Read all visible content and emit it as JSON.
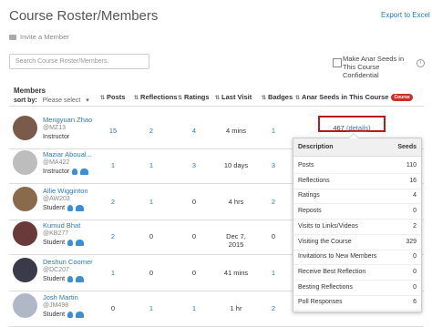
{
  "header": {
    "title": "Course Roster/Members",
    "export_label": "Export to Excel",
    "invite_label": "Invite a Member"
  },
  "search": {
    "placeholder": "Search Course Roster/Members."
  },
  "anonymous": {
    "label": "Make Anar Seeds in This Course Confidential"
  },
  "table": {
    "members_label": "Members",
    "sort_label": "sort by:",
    "sort_value": "Please select",
    "columns": [
      "Posts",
      "Reflections",
      "Ratings",
      "Last Visit",
      "Badges",
      "Anar Seeds in This Course"
    ],
    "course_badge": "Course",
    "rows": [
      {
        "name": "Mengyuan Zhao",
        "handle": "@MZ13",
        "role": "Instructor",
        "posts": "15",
        "reflections": "2",
        "ratings": "4",
        "last_visit": "4 mins",
        "badges": "1",
        "seeds": "467",
        "details": "(details)",
        "avatar": "#7a5a4a"
      },
      {
        "name": "Maziar Aboual...",
        "handle": "@MA422",
        "role": "Instructor",
        "posts": "1",
        "reflections": "1",
        "ratings": "3",
        "last_visit": "10 days",
        "badges": "3",
        "seeds": "",
        "details": "",
        "avatar": "#bdbdbd"
      },
      {
        "name": "Allie Wigginton",
        "handle": "@AW203",
        "role": "Student",
        "posts": "2",
        "reflections": "1",
        "ratings": "0",
        "last_visit": "4 hrs",
        "badges": "2",
        "seeds": "",
        "details": "",
        "avatar": "#8a6a4a"
      },
      {
        "name": "Kumud Bhat",
        "handle": "@KB277",
        "role": "Student",
        "posts": "2",
        "reflections": "0",
        "ratings": "0",
        "last_visit": "Dec 7, 2015",
        "badges": "0",
        "seeds": "",
        "details": "",
        "avatar": "#6a3a3a"
      },
      {
        "name": "Deshun Coomer",
        "handle": "@DC207",
        "role": "Student",
        "posts": "1",
        "reflections": "0",
        "ratings": "0",
        "last_visit": "41 mins",
        "badges": "1",
        "seeds": "",
        "details": "",
        "avatar": "#3a3a4a"
      },
      {
        "name": "Josh Martin",
        "handle": "@JM498",
        "role": "Student",
        "posts": "0",
        "reflections": "1",
        "ratings": "1",
        "last_visit": "1 hr",
        "badges": "2",
        "seeds": "",
        "details": "",
        "avatar": "#b0b8c8"
      }
    ]
  },
  "popup": {
    "col_description": "Description",
    "col_seeds": "Seeds",
    "rows": [
      {
        "d": "Posts",
        "v": "110"
      },
      {
        "d": "Reflections",
        "v": "16"
      },
      {
        "d": "Ratings",
        "v": "4"
      },
      {
        "d": "Reposts",
        "v": "0"
      },
      {
        "d": "Visits to Links/Videos",
        "v": "2"
      },
      {
        "d": "Visiting the Course",
        "v": "329"
      },
      {
        "d": "Invitations to New Members",
        "v": "0"
      },
      {
        "d": "Receive Best Reflection",
        "v": "0"
      },
      {
        "d": "Besting Reflections",
        "v": "0"
      },
      {
        "d": "Poll Responses",
        "v": "6"
      }
    ]
  },
  "colors": {
    "link": "#2a7ab9",
    "highlight": "#b71c1c",
    "badge": "#c9302c"
  }
}
